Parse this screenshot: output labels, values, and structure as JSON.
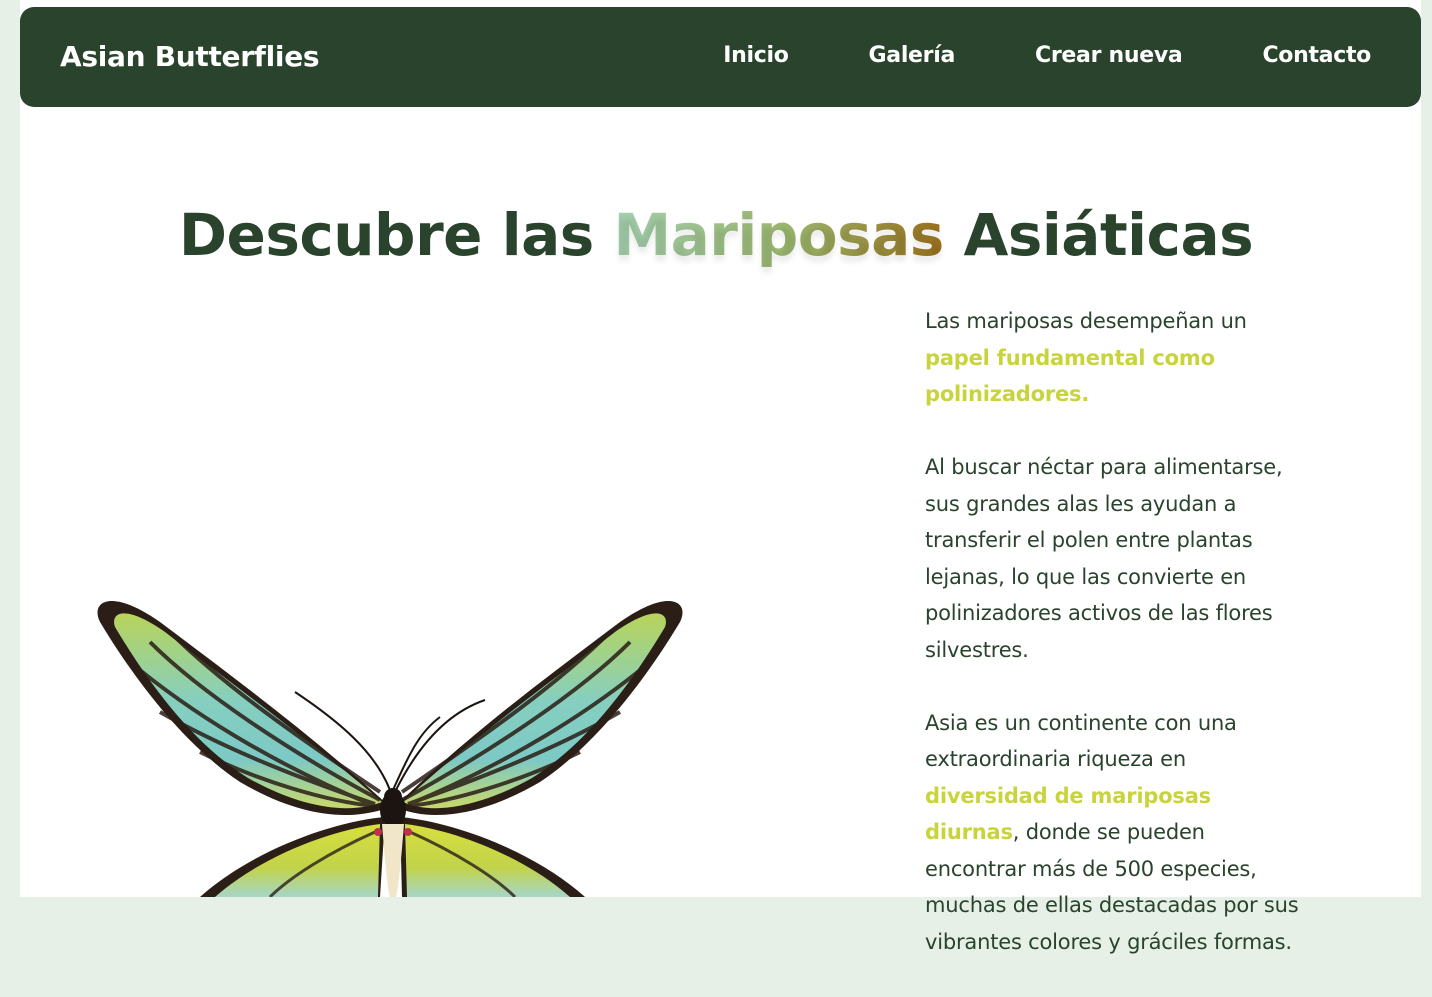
{
  "header": {
    "brand": "Asian Butterflies",
    "nav": [
      "Inicio",
      "Galería",
      "Crear nueva",
      "Contacto"
    ]
  },
  "hero": {
    "title_before": "Descubre las ",
    "title_accent": "Mariposas",
    "title_after": " Asiáticas"
  },
  "content": {
    "p1_text": "Las mariposas desempeñan un ",
    "p1_highlight": "papel fundamental como polinizadores.",
    "p2_text": "Al buscar néctar para alimentarse, sus grandes alas les ayudan a transferir el polen entre plantas lejanas, lo que las convierte en polinizadores activos de las flores silvestres.",
    "p3_text_before": "Asia es un continente con una extraordinaria riqueza en ",
    "p3_highlight": "diversidad de mariposas diurnas",
    "p3_text_after": ", donde se pueden encontrar más de 500 especies, muchas de ellas destacadas por sus vibrantes colores y gráciles formas."
  },
  "colors": {
    "navbar": "#2a432c",
    "highlight": "#c9d43c",
    "page_bg": "#e6f0e6"
  },
  "image": {
    "icon": "butterfly-image"
  }
}
